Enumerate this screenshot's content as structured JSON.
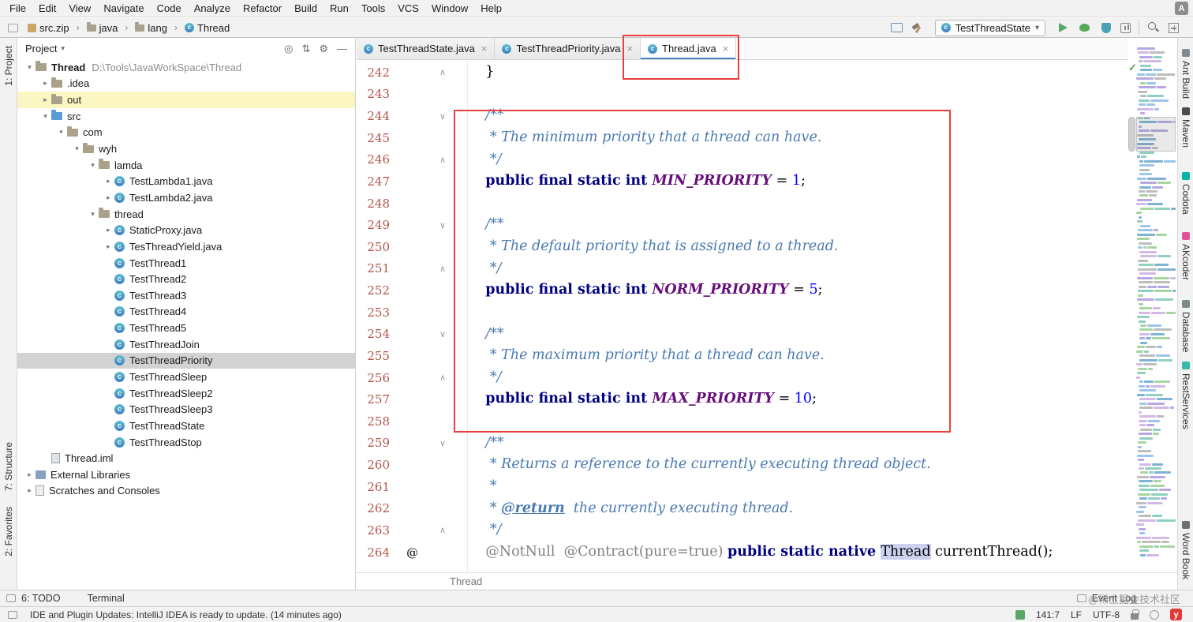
{
  "menu_bar": {
    "items": [
      "File",
      "Edit",
      "View",
      "Navigate",
      "Code",
      "Analyze",
      "Refactor",
      "Build",
      "Run",
      "Tools",
      "VCS",
      "Window",
      "Help"
    ]
  },
  "navbar": {
    "breadcrumbs": [
      {
        "label": "src.zip",
        "icon": "archive"
      },
      {
        "label": "java",
        "icon": "folder"
      },
      {
        "label": "lang",
        "icon": "folder"
      },
      {
        "label": "Thread",
        "icon": "class"
      }
    ],
    "run_config": {
      "label": "TestThreadState"
    }
  },
  "left_strip": {
    "items": [
      {
        "label": "1: Project"
      },
      {
        "label": "7: Structure"
      },
      {
        "label": "2: Favorites"
      }
    ]
  },
  "right_strip": {
    "items": [
      {
        "label": "Ant Build",
        "icon_color": "#7f8b91"
      },
      {
        "label": "Maven",
        "icon_color": "#4b4b4b"
      },
      {
        "label": "Codota",
        "icon_color": "#00b5a3"
      },
      {
        "label": "AKcoder",
        "icon_color": "#e0559a"
      },
      {
        "label": "Database",
        "icon_color": "#7f8b91"
      },
      {
        "label": "RestServices",
        "icon_color": "#3cb8a8"
      },
      {
        "label": "Word Book",
        "icon_color": "#6f6f6f"
      }
    ]
  },
  "project_panel": {
    "title": "Project",
    "tree": [
      {
        "label": "Thread",
        "hint": "D:\\Tools\\JavaWorkSpace\\Thread",
        "level": 0,
        "icon": "folder",
        "chevron": "open",
        "bold": true
      },
      {
        "label": ".idea",
        "level": 1,
        "icon": "folder",
        "chevron": "closed"
      },
      {
        "label": "out",
        "level": 1,
        "icon": "folder",
        "chevron": "closed",
        "highlight": true
      },
      {
        "label": "src",
        "level": 1,
        "icon": "folder-src",
        "chevron": "open"
      },
      {
        "label": "com",
        "level": 2,
        "icon": "folder",
        "chevron": "open"
      },
      {
        "label": "wyh",
        "level": 3,
        "icon": "folder",
        "chevron": "open"
      },
      {
        "label": "lamda",
        "level": 4,
        "icon": "folder",
        "chevron": "open"
      },
      {
        "label": "TestLambda1.java",
        "level": 5,
        "icon": "class",
        "chevron": "closed"
      },
      {
        "label": "TestLambda2.java",
        "level": 5,
        "icon": "class",
        "chevron": "closed"
      },
      {
        "label": "thread",
        "level": 4,
        "icon": "folder",
        "chevron": "open"
      },
      {
        "label": "StaticProxy.java",
        "level": 5,
        "icon": "class",
        "chevron": "closed"
      },
      {
        "label": "TesThreadYield.java",
        "level": 5,
        "icon": "class",
        "chevron": "closed"
      },
      {
        "label": "TestThread1",
        "level": 5,
        "icon": "class"
      },
      {
        "label": "TestThread2",
        "level": 5,
        "icon": "class"
      },
      {
        "label": "TestThread3",
        "level": 5,
        "icon": "class"
      },
      {
        "label": "TestThread4",
        "level": 5,
        "icon": "class"
      },
      {
        "label": "TestThread5",
        "level": 5,
        "icon": "class"
      },
      {
        "label": "TestThreadJoin",
        "level": 5,
        "icon": "class"
      },
      {
        "label": "TestThreadPriority",
        "level": 5,
        "icon": "class",
        "selected": true
      },
      {
        "label": "TestThreadSleep",
        "level": 5,
        "icon": "class"
      },
      {
        "label": "TestThreadSleep2",
        "level": 5,
        "icon": "class"
      },
      {
        "label": "TestThreadSleep3",
        "level": 5,
        "icon": "class"
      },
      {
        "label": "TestThreadState",
        "level": 5,
        "icon": "class"
      },
      {
        "label": "TestThreadStop",
        "level": 5,
        "icon": "class"
      },
      {
        "label": "Thread.iml",
        "level": 1,
        "icon": "iml"
      },
      {
        "label": "External Libraries",
        "level": 0,
        "icon": "lib",
        "chevron": "closed"
      },
      {
        "label": "Scratches and Consoles",
        "level": 0,
        "icon": "scratch",
        "chevron": "closed"
      }
    ]
  },
  "editor": {
    "tabs": [
      {
        "label": "TestThreadState.java",
        "active": false
      },
      {
        "label": "TestThreadPriority.java",
        "active": false
      },
      {
        "label": "Thread.java",
        "active": true
      }
    ],
    "breadcrumb": "Thread",
    "lines": [
      {
        "num": "242",
        "fold": "up",
        "tokens": [
          [
            "    }",
            "plain"
          ]
        ]
      },
      {
        "num": "243",
        "tokens": []
      },
      {
        "num": "244",
        "fold": "down",
        "tokens": [
          [
            "    ",
            "plain"
          ],
          [
            "/**",
            "comment"
          ]
        ]
      },
      {
        "num": "245",
        "tokens": [
          [
            "     ",
            "plain"
          ],
          [
            "* The minimum priority that a thread can have.",
            "comment"
          ]
        ]
      },
      {
        "num": "246",
        "fold": "up",
        "tokens": [
          [
            "     ",
            "plain"
          ],
          [
            "*/",
            "comment"
          ]
        ]
      },
      {
        "num": "247",
        "tokens": [
          [
            "    ",
            "plain"
          ],
          [
            "public final static int ",
            "kw"
          ],
          [
            "MIN_PRIORITY",
            "const"
          ],
          [
            " = ",
            "plain"
          ],
          [
            "1",
            "num"
          ],
          [
            ";",
            "plain"
          ]
        ]
      },
      {
        "num": "248",
        "tokens": []
      },
      {
        "num": "249",
        "fold": "down",
        "tokens": [
          [
            "    ",
            "plain"
          ],
          [
            "/**",
            "comment"
          ]
        ]
      },
      {
        "num": "250",
        "tokens": [
          [
            "     ",
            "plain"
          ],
          [
            "* The default priority that is assigned to a thread.",
            "comment"
          ]
        ]
      },
      {
        "num": "251",
        "fold": "up",
        "tokens": [
          [
            "     ",
            "plain"
          ],
          [
            "*/",
            "comment"
          ]
        ]
      },
      {
        "num": "252",
        "tokens": [
          [
            "    ",
            "plain"
          ],
          [
            "public final static int ",
            "kw"
          ],
          [
            "NORM_PRIORITY",
            "const"
          ],
          [
            " = ",
            "plain"
          ],
          [
            "5",
            "num"
          ],
          [
            ";",
            "plain"
          ]
        ]
      },
      {
        "num": "253",
        "tokens": []
      },
      {
        "num": "254",
        "fold": "down",
        "tokens": [
          [
            "    ",
            "plain"
          ],
          [
            "/**",
            "comment"
          ]
        ]
      },
      {
        "num": "255",
        "tokens": [
          [
            "     ",
            "plain"
          ],
          [
            "* The maximum priority that a thread can have.",
            "comment"
          ]
        ]
      },
      {
        "num": "256",
        "fold": "up",
        "tokens": [
          [
            "     ",
            "plain"
          ],
          [
            "*/",
            "comment"
          ]
        ]
      },
      {
        "num": "257",
        "tokens": [
          [
            "    ",
            "plain"
          ],
          [
            "public final static int ",
            "kw"
          ],
          [
            "MAX_PRIORITY",
            "const"
          ],
          [
            " = ",
            "plain"
          ],
          [
            "10",
            "num"
          ],
          [
            ";",
            "plain"
          ]
        ]
      },
      {
        "num": "258",
        "tokens": []
      },
      {
        "num": "259",
        "fold": "down",
        "tokens": [
          [
            "    ",
            "plain"
          ],
          [
            "/**",
            "comment"
          ]
        ]
      },
      {
        "num": "260",
        "tokens": [
          [
            "     ",
            "plain"
          ],
          [
            "* Returns a reference to the currently executing thread object.",
            "comment"
          ]
        ]
      },
      {
        "num": "261",
        "tokens": [
          [
            "     ",
            "plain"
          ],
          [
            "*",
            "comment"
          ]
        ]
      },
      {
        "num": "262",
        "tokens": [
          [
            "     ",
            "plain"
          ],
          [
            "* ",
            "comment"
          ],
          [
            "@return",
            "doctag"
          ],
          [
            "  the currently executing thread.",
            "comment"
          ]
        ]
      },
      {
        "num": "263",
        "fold": "up",
        "tokens": [
          [
            "     ",
            "plain"
          ],
          [
            "*/",
            "comment"
          ]
        ]
      },
      {
        "num": "264",
        "gutter": "@",
        "tokens": [
          [
            "    ",
            "plain"
          ],
          [
            "@NotNull  ",
            "ann"
          ],
          [
            "@Contract(pure=true) ",
            "ann"
          ],
          [
            "public static native ",
            "kw"
          ],
          [
            "Thread",
            "classref"
          ],
          [
            " currentThread();",
            "plain"
          ]
        ]
      }
    ]
  },
  "bottom_bar": {
    "todo": "6: TODO",
    "terminal": "Terminal",
    "event_log": "Event Log"
  },
  "status_bar": {
    "message": "IDE and Plugin Updates: IntelliJ IDEA is ready to update. (14 minutes ago)",
    "caret": "141:7",
    "line_sep": "LF",
    "encoding": "UTF-8"
  },
  "watermark": "@稀土掘金技术社区",
  "icons": {
    "caret_down": "▾",
    "chevron_open": "▾",
    "chevron_closed": "▸",
    "fold_start": "∨",
    "fold_end": "∧",
    "crumb_sep": "›",
    "close": "×",
    "check": "✓",
    "locate": "◎",
    "collapse": "⇅",
    "gear": "⚙",
    "hide": "—",
    "ime": "A"
  },
  "colors": {
    "annotation_red": "#e8413c",
    "selection_gray": "#d2d2d2",
    "row_highlight": "#fbf6c2",
    "keyword_blue": "#000080",
    "comment_blue": "#4a7ab0",
    "constant_purple": "#660e7a",
    "number_blue": "#0000ff",
    "line_number_red": "#b0564a",
    "classref_bg": "#ccd1f0",
    "run_green": "#59a869"
  }
}
